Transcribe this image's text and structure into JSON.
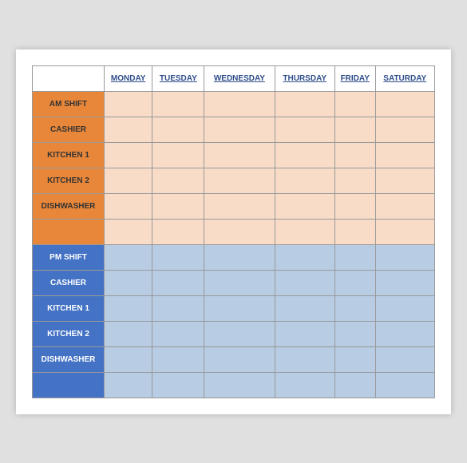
{
  "table": {
    "columns": [
      "",
      "MONDAY",
      "TUESDAY",
      "WEDNESDAY",
      "THURSDAY",
      "FRIDAY",
      "SATURDAY"
    ],
    "am_section": {
      "shift_label": "AM SHIFT",
      "rows": [
        {
          "label": "CASHIER"
        },
        {
          "label": "KITCHEN 1"
        },
        {
          "label": "KITCHEN 2"
        },
        {
          "label": "DISHWASHER"
        },
        {
          "label": ""
        }
      ]
    },
    "pm_section": {
      "shift_label": "PM SHIFT",
      "rows": [
        {
          "label": "CASHIER"
        },
        {
          "label": "KITCHEN 1"
        },
        {
          "label": "KITCHEN 2"
        },
        {
          "label": "DISHWASHER"
        },
        {
          "label": ""
        }
      ]
    }
  }
}
